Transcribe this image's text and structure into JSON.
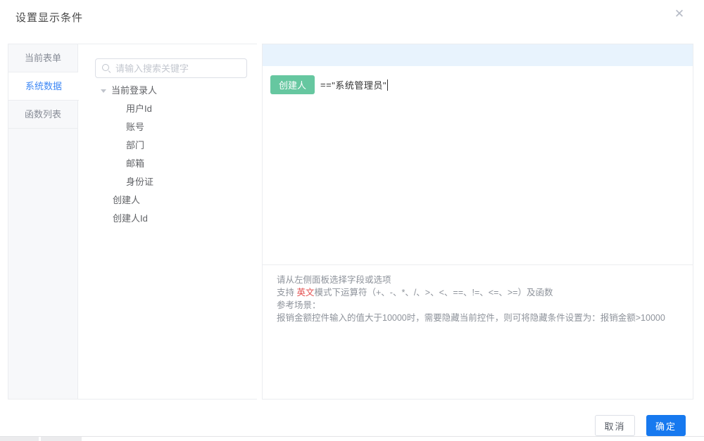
{
  "dialog": {
    "title": "设置显示条件",
    "close_glyph": "✕"
  },
  "tabs": [
    {
      "label": "当前表单",
      "active": false
    },
    {
      "label": "系统数据",
      "active": true
    },
    {
      "label": "函数列表",
      "active": false
    }
  ],
  "search": {
    "placeholder": "请输入搜索关键字",
    "icon": "search-icon"
  },
  "tree": {
    "items": [
      {
        "label": "当前登录人",
        "level": 0,
        "expanded": true,
        "icon": "caret-down-icon"
      },
      {
        "label": "用户Id",
        "level": 1
      },
      {
        "label": "账号",
        "level": 1
      },
      {
        "label": "部门",
        "level": 1
      },
      {
        "label": "邮箱",
        "level": 1
      },
      {
        "label": "身份证",
        "level": 1
      },
      {
        "label": "创建人",
        "level": 0
      },
      {
        "label": "创建人Id",
        "level": 0
      }
    ]
  },
  "expression": {
    "field_tag": "创建人",
    "operator": "==",
    "value_text": "\"系统管理员\"",
    "tag_color": "#66c7a0"
  },
  "help": {
    "line1": "请从左侧面板选择字段或选项",
    "line2_prefix": "支持 ",
    "line2_highlight": "英文",
    "line2_suffix": "模式下运算符（+、-、*、/、>、<、==、!=、<=、>=）及函数",
    "line3": "参考场景：",
    "line4": "报销金额控件输入的值大于10000时，需要隐藏当前控件，则可将隐藏条件设置为：报销金额>10000",
    "highlight_color": "#e34d4d"
  },
  "footer": {
    "cancel_label": "取消",
    "ok_label": "确定",
    "ok_color": "#1779ef"
  }
}
